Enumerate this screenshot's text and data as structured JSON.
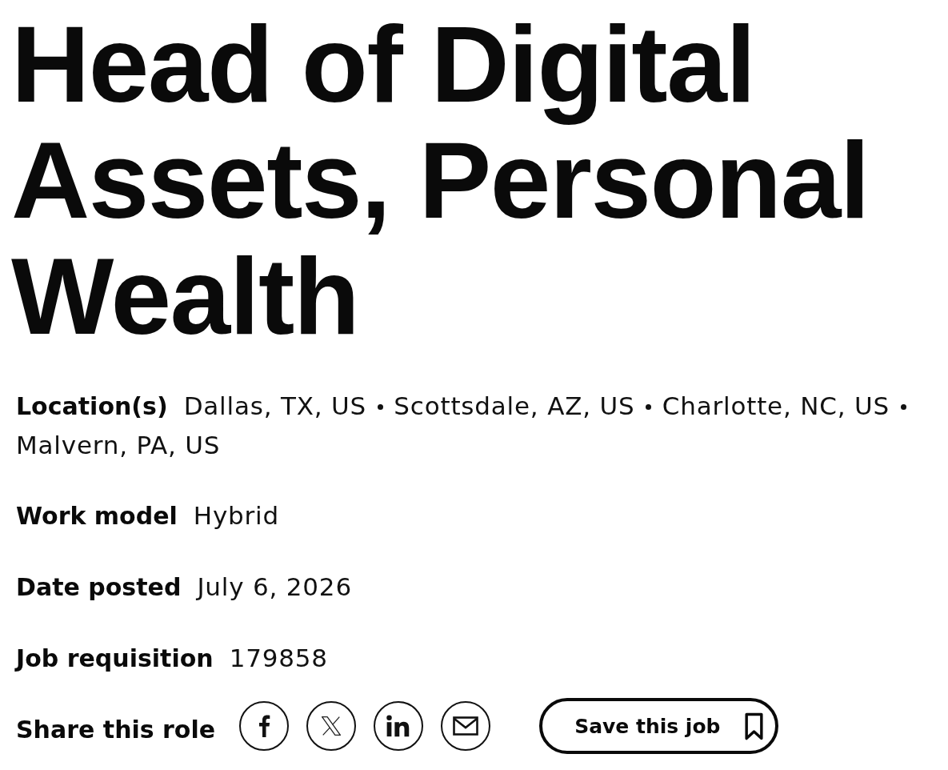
{
  "job_title": "Head of Digital Assets, Personal Wealth",
  "details": [
    {
      "kind": "list",
      "label": "Location(s)",
      "values": [
        "Dallas, TX, US",
        "Scottsdale, AZ, US",
        "Charlotte, NC, US",
        "Malvern, PA, US"
      ]
    },
    {
      "kind": "text",
      "label": "Work model",
      "value": "Hybrid"
    },
    {
      "kind": "text",
      "label": "Date posted",
      "value": "July 6, 2026"
    },
    {
      "kind": "text",
      "label": "Job requisition",
      "value": "179858"
    }
  ],
  "share": {
    "label": "Share this role",
    "buttons": [
      {
        "kind": "facebook"
      },
      {
        "kind": "x"
      },
      {
        "kind": "linkedin"
      },
      {
        "kind": "email"
      }
    ]
  },
  "save_button": {
    "label": "Save this job"
  }
}
